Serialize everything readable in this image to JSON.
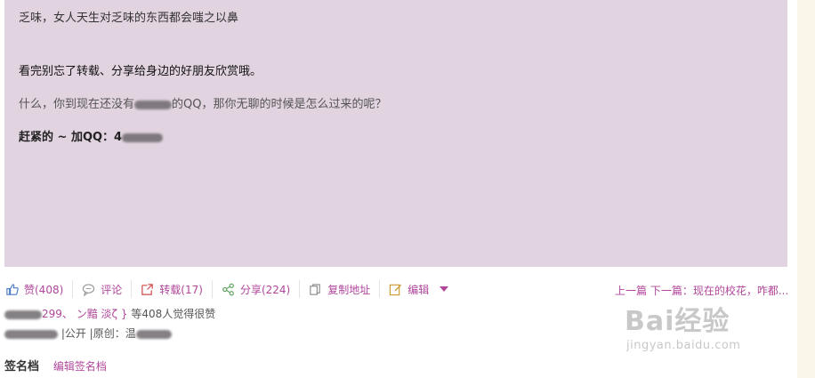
{
  "post": {
    "line1": "乏味，女人天生对乏味的东西都会嗤之以鼻",
    "line2": "看完别忘了转载、分享给身边的好朋友欣赏哦。",
    "line3_before": "什么，你到现在还没有",
    "line3_after": "的QQ，那你无聊的时候是怎么过来的呢？",
    "line4": "赶紧的 ~ 加QQ：4"
  },
  "toolbar": {
    "like": "赞(408)",
    "comment": "评论",
    "repost": "转载(17)",
    "share": "分享(224)",
    "copy": "复制地址",
    "edit": "编辑"
  },
  "nav": {
    "prev": "上一篇",
    "next": "下一篇：现在的校花，咋都..."
  },
  "likes": {
    "users_suffix": "299、",
    "user2": "ン黯 淡ζ }",
    "summary": " 等408人觉得很赞"
  },
  "meta": {
    "visibility": "|公开 |原创：",
    "author_blurred": "温"
  },
  "signature": {
    "title": "签名档",
    "edit": "编辑签名档"
  },
  "watermark": {
    "logo": "Bai经验",
    "site": "jingyan.baidu.com"
  },
  "colors": {
    "accent": "#b0479b",
    "card_bg": "#e1d3e0"
  },
  "icons": [
    "thumbs-up-icon",
    "comment-icon",
    "repost-icon",
    "share-icon",
    "copy-icon",
    "edit-icon",
    "caret-down-icon"
  ]
}
